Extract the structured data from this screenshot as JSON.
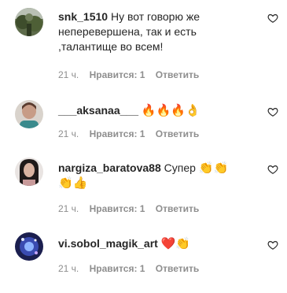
{
  "comments": [
    {
      "username": "snk_1510",
      "text_line1": "Ну вот говорю же",
      "text_line2": "неперевершена, так и есть",
      "text_line3": ",талантище во всем!",
      "emoji": "",
      "emoji_line2": "",
      "time": "21 ч.",
      "likes": "Нравится: 1",
      "reply": "Ответить",
      "avatar_icon": "forest-photo-avatar"
    },
    {
      "username": "___aksanaa___",
      "text_line1": "",
      "emoji": "🔥🔥🔥👌",
      "time": "21 ч.",
      "likes": "Нравится: 1",
      "reply": "Ответить",
      "avatar_icon": "woman-photo-avatar"
    },
    {
      "username": "nargiza_baratova88",
      "text_line1": "Супер",
      "emoji": "👏👏",
      "emoji_line2": "👏👍",
      "time": "21 ч.",
      "likes": "Нравится: 1",
      "reply": "Ответить",
      "avatar_icon": "woman-dark-hair-avatar"
    },
    {
      "username": "vi.sobol_magik_art",
      "text_line1": "",
      "emoji": "❤️👏",
      "time": "21 ч.",
      "likes": "Нравится: 1",
      "reply": "Ответить",
      "avatar_icon": "sparkle-art-avatar"
    }
  ],
  "colors": {
    "text": "#262626",
    "meta": "#8e8e8e",
    "heart_outline": "#262626"
  }
}
